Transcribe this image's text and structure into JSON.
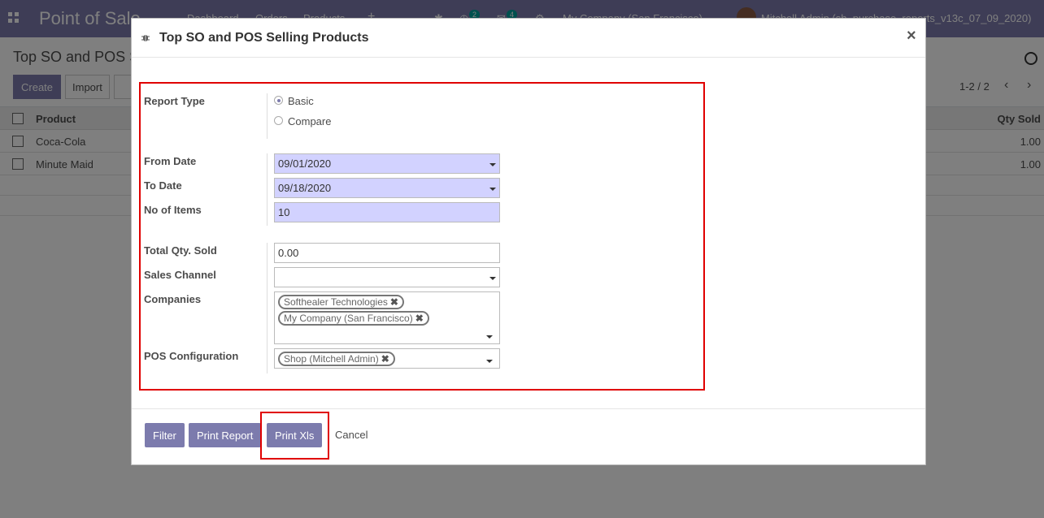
{
  "navbar": {
    "brand": "Point of Sale",
    "menu": [
      "Dashboard",
      "Orders",
      "Products"
    ],
    "plus": "+",
    "badge_activity": "2",
    "badge_messages": "4",
    "company": "My Company (San Francisco)",
    "user": "Mitchell Admin (sh_purchase_reports_v13c_07_09_2020)"
  },
  "control_panel": {
    "breadcrumb": "Top SO and POS Selling Products",
    "create_label": "Create",
    "import_label": "Import",
    "pager": "1-2 / 2"
  },
  "list": {
    "col_product": "Product",
    "col_qty": "Qty Sold",
    "rows": [
      {
        "product": "Coca-Cola",
        "qty": "1.00"
      },
      {
        "product": "Minute Maid",
        "qty": "1.00"
      }
    ]
  },
  "modal": {
    "title": "Top SO and POS Selling Products",
    "close": "×",
    "labels": {
      "report_type": "Report Type",
      "from_date": "From Date",
      "to_date": "To Date",
      "no_items": "No of Items",
      "total_qty": "Total Qty. Sold",
      "sales_channel": "Sales Channel",
      "companies": "Companies",
      "pos_config": "POS Configuration"
    },
    "report_type_options": [
      "Basic",
      "Compare"
    ],
    "report_type_selected": "Basic",
    "from_date": "09/01/2020",
    "to_date": "09/18/2020",
    "no_items": "10",
    "total_qty": "0.00",
    "sales_channel": "",
    "companies": [
      "Softhealer Technologies",
      "My Company (San Francisco)"
    ],
    "pos_configurations": [
      "Shop (Mitchell Admin)"
    ],
    "tag_remove": "✖",
    "buttons": {
      "filter": "Filter",
      "print_report": "Print Report",
      "print_xls": "Print Xls",
      "cancel": "Cancel"
    }
  }
}
